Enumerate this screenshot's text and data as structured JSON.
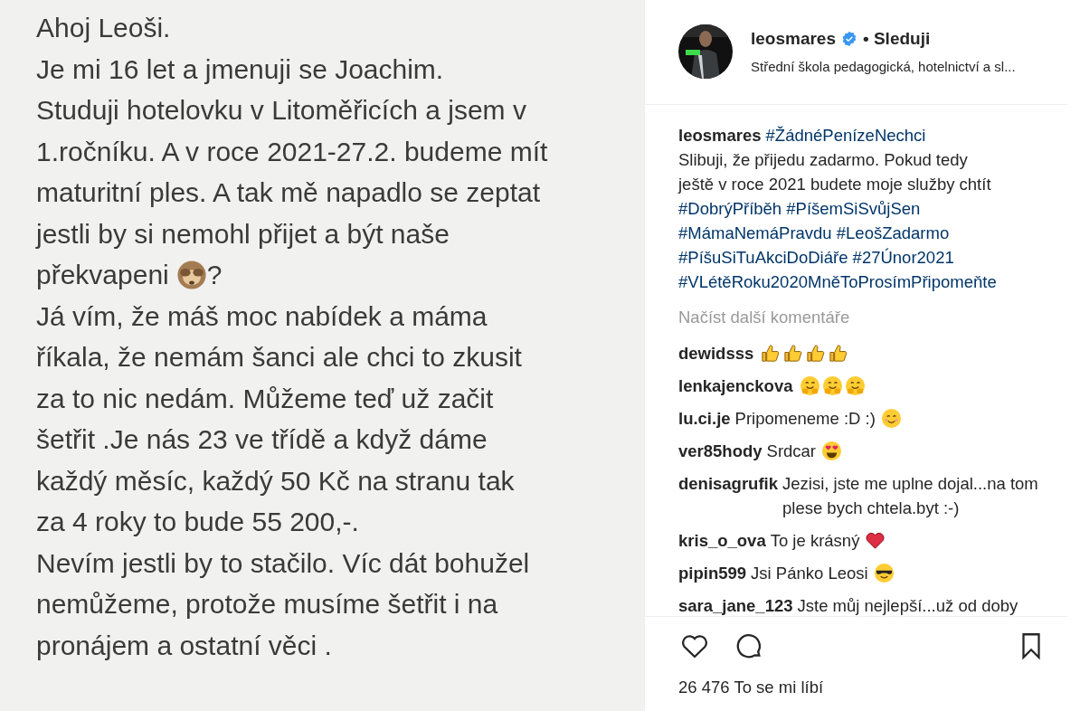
{
  "note": {
    "lines": [
      {
        "text": "Ahoj Leoši."
      },
      {
        "text": "Je mi 16 let a jmenuji se Joachim."
      },
      {
        "text": "Studuji hotelovku v Litoměřicích a jsem v"
      },
      {
        "text": "1.ročníku. A v roce 2021-27.2. budeme mít"
      },
      {
        "text": "maturitní ples. A tak mě napadlo se zeptat"
      },
      {
        "text": "jestli by si nemohl přijet a být naše"
      },
      {
        "text": "překvapeni",
        "emoji": {
          "kind": "monkey"
        },
        "after": "?"
      },
      {
        "text": "Já vím, že máš moc nabídek a máma"
      },
      {
        "text": "říkala, že nemám šanci ale chci to zkusit"
      },
      {
        "text": "za to nic nedám. Můžeme teď už začit"
      },
      {
        "text": "šetřit .Je nás 23 ve třídě a když dáme"
      },
      {
        "text": "každý měsíc, každý 50 Kč na stranu tak"
      },
      {
        "text": "za 4 roky to bude 55 200,-."
      },
      {
        "text": "Nevím jestli by to stačilo. Víc dát bohužel"
      },
      {
        "text": "nemůžeme, protože musíme šetřit i na"
      },
      {
        "text": "pronájem a ostatní věci ."
      }
    ]
  },
  "header": {
    "username": "leosmares",
    "verified": true,
    "follow": "• Sleduji",
    "location": "Střední škola pedagogická, hotelnictví a sl..."
  },
  "caption": {
    "username": "leosmares",
    "lines": [
      {
        "kind": "tags",
        "text": "#ŽádnéPenízeNechci"
      },
      {
        "kind": "text",
        "text": "Slibuji, že přijedu zadarmo. Pokud tedy"
      },
      {
        "kind": "text",
        "text": "ještě v roce 2021 budete moje služby chtít"
      },
      {
        "kind": "tags",
        "text": "#DobrýPříběh #PíšemSiSvůjSen"
      },
      {
        "kind": "tags",
        "text": "#MámaNemáPravdu #LeošZadarmo"
      },
      {
        "kind": "tags",
        "text": "#PíšuSiTuAkciDoDiáře #27Únor2021"
      },
      {
        "kind": "tags",
        "text": "#VLétěRoku2020MněToProsímPřipomeňte"
      }
    ]
  },
  "load_more": "Načíst další komentáře",
  "comments": [
    {
      "username": "dewidsss",
      "emojis": [
        {
          "kind": "thumbs"
        },
        {
          "kind": "thumbs"
        },
        {
          "kind": "thumbs"
        },
        {
          "kind": "thumbs"
        }
      ]
    },
    {
      "username": "lenkajenckova",
      "emojis": [
        {
          "kind": "hug"
        },
        {
          "kind": "hug"
        },
        {
          "kind": "hug"
        }
      ]
    },
    {
      "username": "lu.ci.je",
      "text": "Pripomeneme :D :)",
      "emojis": [
        {
          "kind": "smile"
        }
      ]
    },
    {
      "username": "ver85hody",
      "text": "Srdcar",
      "emojis": [
        {
          "kind": "hearteyes"
        }
      ]
    },
    {
      "username": "denisagrufik",
      "text": "Jezisi, jste me uplne dojal...na tom plese bych chtela.byt :-)"
    },
    {
      "username": "kris_o_ova",
      "text": "To je krásný",
      "emojis": [
        {
          "kind": "heart"
        }
      ]
    },
    {
      "username": "pipin599",
      "text": "Jsi Pánko Leosi",
      "emojis": [
        {
          "kind": "sunglasses"
        }
      ]
    },
    {
      "username": "sara_jane_123",
      "text": "Jste můj nejlepší...už od doby"
    }
  ],
  "likes": "26 476 To se mi líbí"
}
